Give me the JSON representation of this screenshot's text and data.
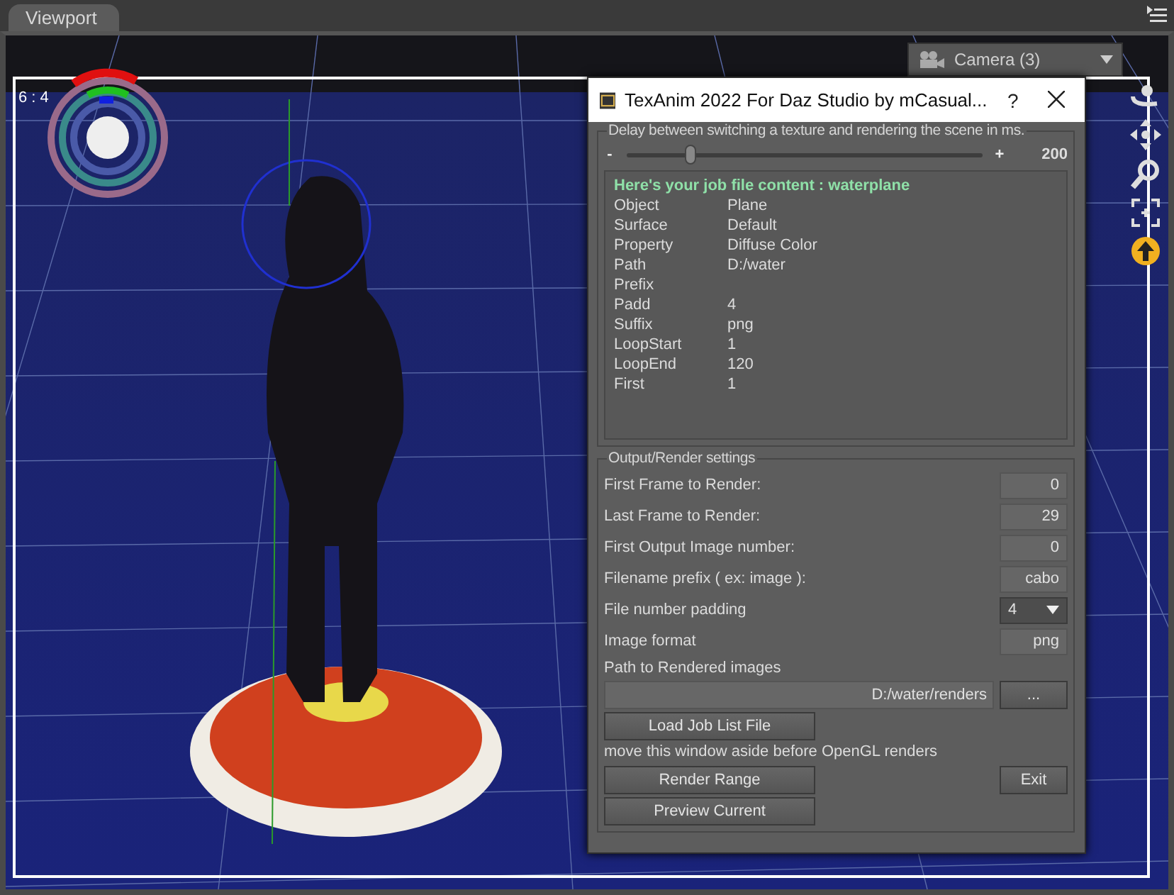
{
  "viewport_tab": {
    "label": "Viewport",
    "selected": true
  },
  "aspect_label": "6 : 4",
  "camera_dropdown": {
    "value": "Camera (3)"
  },
  "dialog": {
    "title": "TexAnim 2022 For Daz Studio by mCasual...",
    "help": "?",
    "delay_group": {
      "title": "Delay between switching a texture and rendering the scene in ms.",
      "minus": "-",
      "plus": "+",
      "slider": {
        "level": 0.18
      },
      "value": "200"
    },
    "job": {
      "heading": "Here's your job file content : waterplane",
      "rows": [
        {
          "key": "Object",
          "value": "Plane"
        },
        {
          "key": "Surface",
          "value": "Default"
        },
        {
          "key": "Property",
          "value": "Diffuse Color"
        },
        {
          "key": "Path",
          "value": "D:/water"
        },
        {
          "key": "Prefix"
        },
        {
          "key": "Padd",
          "value": "4"
        },
        {
          "key": "Suffix",
          "value": "png"
        },
        {
          "key": "LoopStart",
          "value": "1"
        },
        {
          "key": "LoopEnd",
          "value": "120"
        },
        {
          "key": "First",
          "value": "1"
        }
      ]
    },
    "output_group": {
      "title": "Output/Render settings",
      "settings": [
        {
          "kind": "field",
          "label": "First Frame to Render:",
          "value": "0"
        },
        {
          "kind": "field",
          "label": "Last Frame to Render:",
          "value": "29"
        },
        {
          "kind": "field",
          "label": "First Output Image number:",
          "value": "0"
        },
        {
          "kind": "field",
          "label": "Filename prefix ( ex: image ):",
          "value": "cabo"
        },
        {
          "kind": "dropdown",
          "label": "File number padding",
          "value": "4"
        },
        {
          "kind": "field",
          "label": "Image format",
          "value": "png"
        }
      ],
      "path_label": "Path to Rendered images",
      "path_value": "D:/water/renders",
      "browse_button": "...",
      "load_button": "Load Job List File",
      "note": "move this window aside before OpenGL renders",
      "render_button": "Render Range",
      "exit_button": "Exit",
      "preview_button": "Preview Current"
    }
  }
}
